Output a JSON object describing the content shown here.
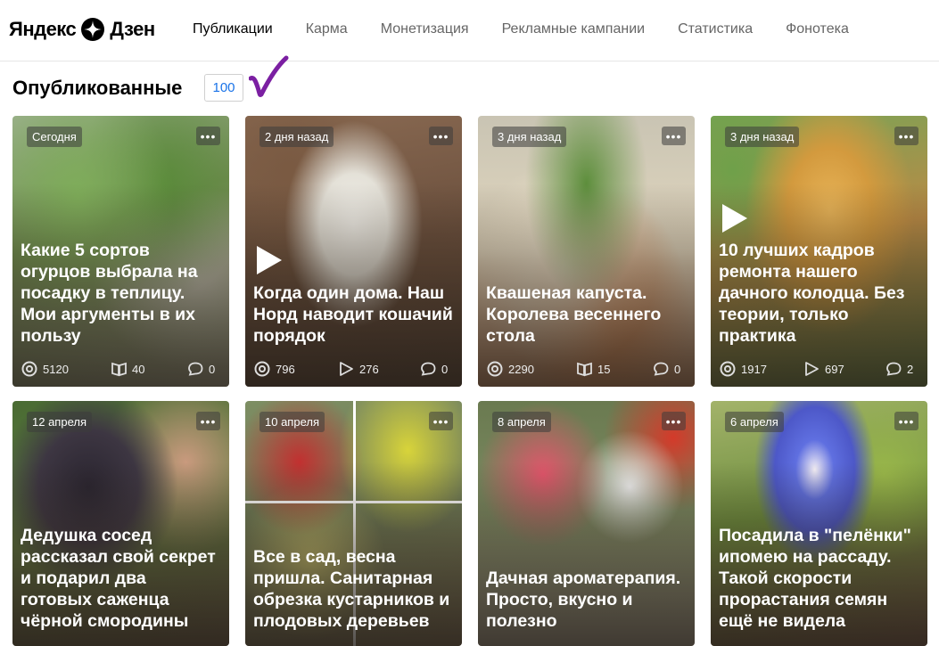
{
  "header": {
    "logo_text": "Яндекс",
    "logo_text2": "Дзен",
    "nav": [
      {
        "label": "Публикации",
        "active": true
      },
      {
        "label": "Карма"
      },
      {
        "label": "Монетизация"
      },
      {
        "label": "Рекламные кампании"
      },
      {
        "label": "Статистика"
      },
      {
        "label": "Фонотека"
      }
    ]
  },
  "section": {
    "title": "Опубликованные",
    "count": "100"
  },
  "cards": [
    {
      "date": "Сегодня",
      "title": "Какие 5 сортов огурцов выбрала на посадку в теплицу. Мои аргументы в их пользу",
      "views": "5120",
      "reads": "40",
      "comments": "0",
      "kind": "article"
    },
    {
      "date": "2 дня назад",
      "title": "Когда один дома. Наш Норд наводит кошачий порядок",
      "views": "796",
      "plays": "276",
      "comments": "0",
      "kind": "video"
    },
    {
      "date": "3 дня назад",
      "title": "Квашеная капуста. Королева весеннего стола",
      "views": "2290",
      "reads": "15",
      "comments": "0",
      "kind": "article"
    },
    {
      "date": "3 дня назад",
      "title": "10 лучших кадров ремонта нашего дачного колодца. Без теории, только практика",
      "views": "1917",
      "plays": "697",
      "comments": "2",
      "kind": "video"
    },
    {
      "date": "12 апреля",
      "title": "Дедушка сосед рассказал свой секрет и подарил два готовых саженца чёрной смородины"
    },
    {
      "date": "10 апреля",
      "title": "Все в сад, весна пришла. Санитарная обрезка кустарников и плодовых деревьев"
    },
    {
      "date": "8 апреля",
      "title": "Дачная ароматерапия. Просто, вкусно и полезно"
    },
    {
      "date": "6 апреля",
      "title": "Посадила в \"пелёнки\" ипомею на рассаду. Такой скорости прорастания семян ещё не видела"
    }
  ],
  "more_label": "•••",
  "colors": {
    "accent": "#1a73e8",
    "checkmark": "#7b1fa2"
  }
}
